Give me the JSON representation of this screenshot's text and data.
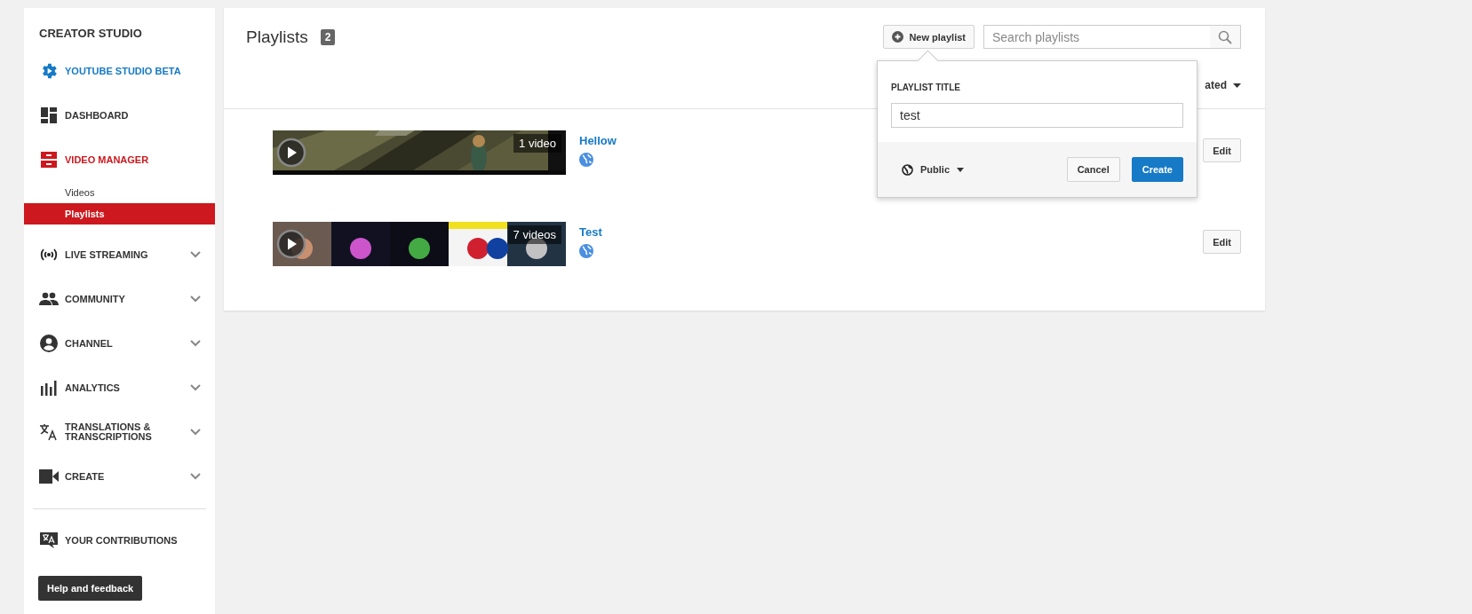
{
  "sidebar": {
    "heading": "CREATOR STUDIO",
    "items": [
      {
        "label": "YOUTUBE STUDIO BETA",
        "kind": "beta",
        "active": false
      },
      {
        "label": "DASHBOARD",
        "kind": "link",
        "active": false
      },
      {
        "label": "VIDEO MANAGER",
        "kind": "section",
        "active": true,
        "children": [
          {
            "label": "Videos",
            "selected": false
          },
          {
            "label": "Playlists",
            "selected": true
          }
        ]
      },
      {
        "label": "LIVE STREAMING",
        "kind": "expandable",
        "active": false,
        "expanded": false
      },
      {
        "label": "COMMUNITY",
        "kind": "expandable",
        "active": false,
        "expanded": false
      },
      {
        "label": "CHANNEL",
        "kind": "expandable",
        "active": false,
        "expanded": false
      },
      {
        "label": "ANALYTICS",
        "kind": "expandable",
        "active": false,
        "expanded": false
      },
      {
        "label": "TRANSLATIONS & TRANSCRIPTIONS",
        "kind": "expandable",
        "active": false,
        "expanded": false
      },
      {
        "label": "CREATE",
        "kind": "expandable",
        "active": false,
        "expanded": false
      }
    ],
    "contributions": "YOUR CONTRIBUTIONS",
    "help_button": "Help and feedback"
  },
  "main": {
    "title": "Playlists",
    "count": "2",
    "new_button": "New playlist",
    "search": {
      "placeholder": "Search playlists"
    },
    "sort_label": "ated",
    "playlists": [
      {
        "title": "Hellow",
        "video_count": "1 video",
        "edit": "Edit"
      },
      {
        "title": "Test",
        "video_count": "7 videos",
        "edit": "Edit"
      }
    ],
    "popup": {
      "label": "PLAYLIST TITLE",
      "value": "test",
      "privacy": "Public",
      "buttons": [
        "Cancel",
        "Create"
      ]
    }
  }
}
